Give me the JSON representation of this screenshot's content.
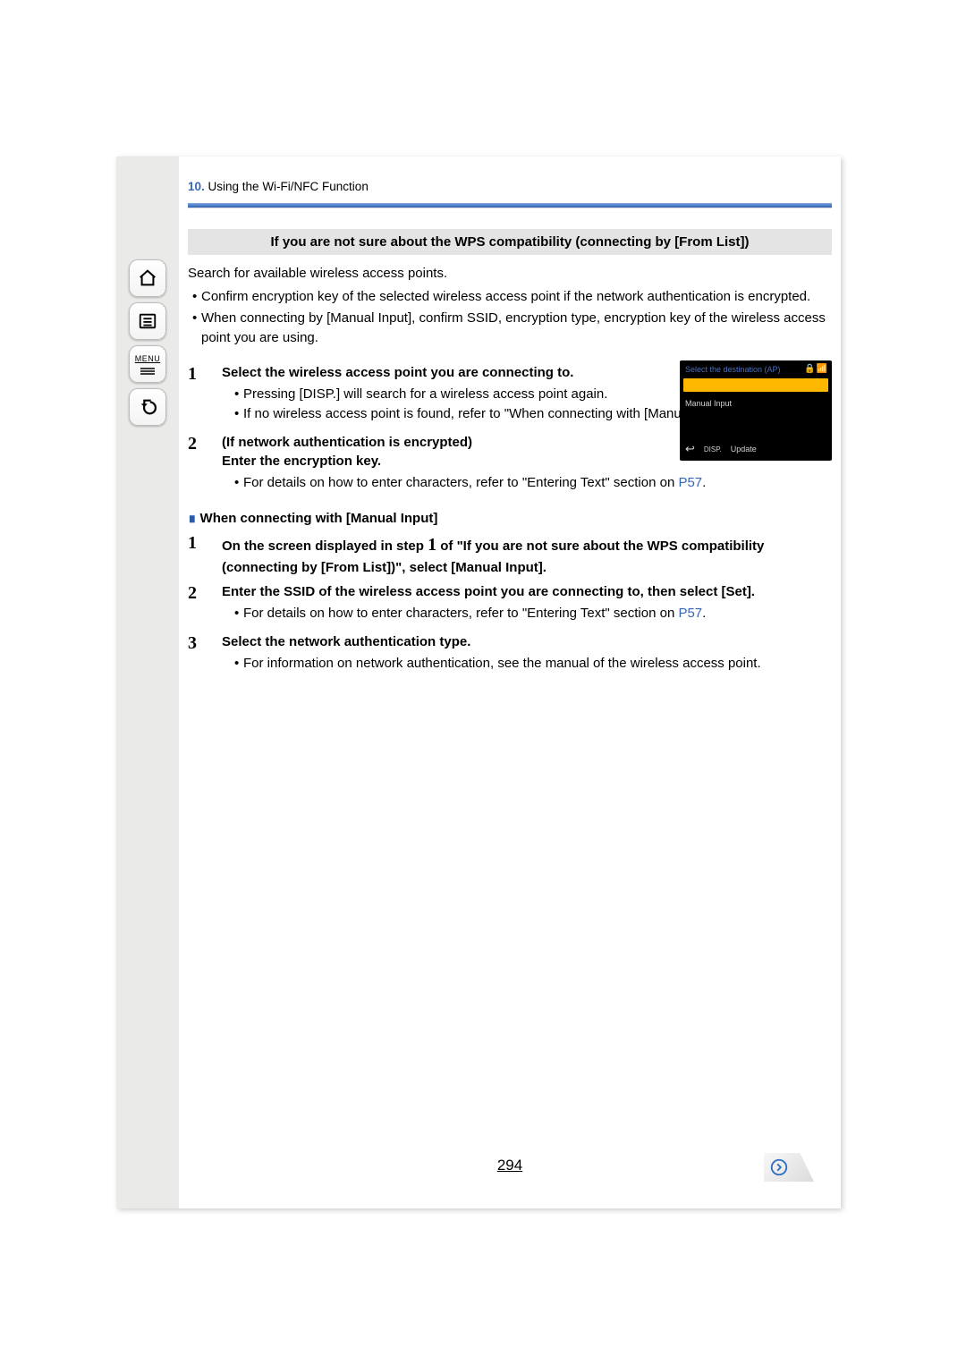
{
  "crumb": {
    "num": "10.",
    "text": " Using the Wi-Fi/NFC Function"
  },
  "sidebar": {
    "home_name": "home-icon",
    "toc_name": "list-icon",
    "menu_label": "MENU",
    "back_name": "back-icon"
  },
  "section_title": "If you are not sure about the WPS compatibility (connecting by [From List])",
  "intro": "Search for available wireless access points.",
  "intro_bullets": [
    "Confirm encryption key of the selected wireless access point if the network authentication is encrypted.",
    "When connecting by [Manual Input], confirm SSID, encryption type, encryption key of the wireless access point you are using."
  ],
  "steps_a": [
    {
      "n": "1",
      "bold": "Select the wireless access point you are connecting to.",
      "dots": [
        "Pressing [DISP.] will search for a wireless access point again.",
        "If no wireless access point is found, refer to \"When connecting with [Manual Input]\"."
      ]
    },
    {
      "n": "2",
      "bold": "(If network authentication is encrypted)\nEnter the encryption key.",
      "dots_linked": {
        "pre": "For details on how to enter characters, refer to \"Entering Text\" section on ",
        "link": "P57",
        "post": "."
      }
    }
  ],
  "subhead": "When connecting with [Manual Input]",
  "steps_b": [
    {
      "n": "1",
      "bold_parts": {
        "pre": "On the screen displayed in step ",
        "big": "1",
        "post": " of \"If you are not sure about the WPS compatibility (connecting by [From List])\", select [Manual Input]."
      }
    },
    {
      "n": "2",
      "bold": "Enter the SSID of the wireless access point you are connecting to, then select [Set].",
      "dots_linked": {
        "pre": "For details on how to enter characters, refer to \"Entering Text\" section on ",
        "link": "P57",
        "post": "."
      }
    },
    {
      "n": "3",
      "bold": "Select the network authentication type.",
      "dots": [
        "For information on network authentication, see the manual of the wireless access point."
      ]
    }
  ],
  "shot": {
    "title": "Select the destination (AP)",
    "selected": "",
    "item2": "Manual Input",
    "disp": "DISP.",
    "update": "Update"
  },
  "page_number": "294"
}
